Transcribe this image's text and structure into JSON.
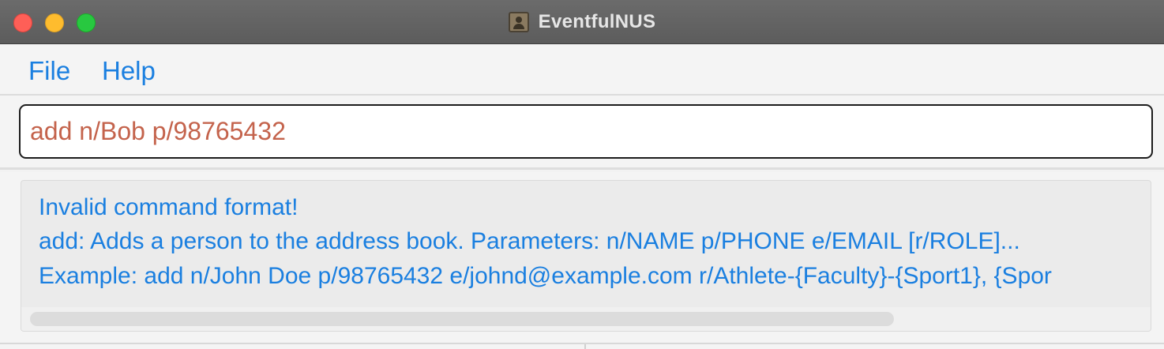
{
  "window": {
    "title": "EventfulNUS",
    "icon": "address-book-icon"
  },
  "menu": {
    "items": [
      {
        "label": "File"
      },
      {
        "label": "Help"
      }
    ]
  },
  "command_box": {
    "value": "add n/Bob p/98765432"
  },
  "result_display": {
    "lines": [
      "Invalid command format!",
      "add: Adds a person to the address book. Parameters: n/NAME p/PHONE e/EMAIL [r/ROLE]...",
      "Example: add n/John Doe p/98765432 e/johnd@example.com r/Athlete-{Faculty}-{Sport1}, {Spor"
    ]
  },
  "colors": {
    "accent": "#1a7fe0",
    "command_text": "#c4634c",
    "titlebar": "#5c5c5c"
  }
}
